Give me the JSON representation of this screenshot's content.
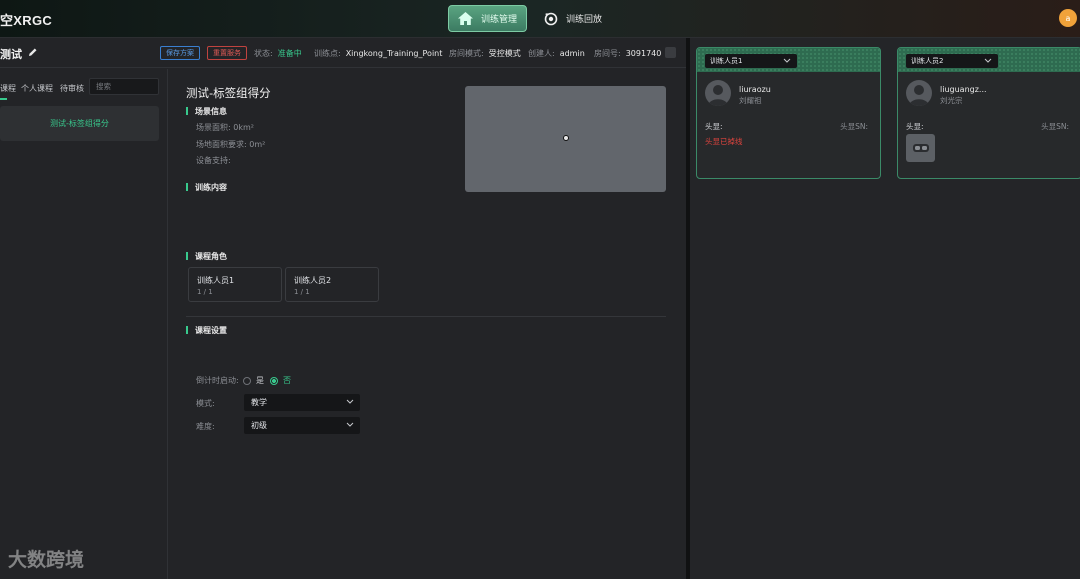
{
  "app": {
    "logo": "空XRGC"
  },
  "nav": {
    "manage_label": "训练管理",
    "replay_label": "训练回放"
  },
  "user": {
    "avatar_letter": "a"
  },
  "header": {
    "project_title": "测试",
    "save_plan": "保存方案",
    "reset_plan": "重置服务",
    "status_label": "状态:",
    "status_value": "准备中",
    "point_label": "训练点:",
    "point_value": "Xingkong_Training_Point",
    "mode_label": "房间模式:",
    "mode_value": "受控模式",
    "creator_label": "创建人:",
    "creator_value": "admin",
    "room_label": "房间号:",
    "room_value": "3091740"
  },
  "course_list": {
    "tabs": [
      "课程",
      "个人课程",
      "待审核"
    ],
    "search_placeholder": "搜索",
    "items": [
      "测试-标签组得分"
    ]
  },
  "detail": {
    "title": "测试-标签组得分",
    "scene_section": "场景信息",
    "scene_area": "场景面积:  0km²",
    "floor_area": "场地面积要求:  0m²",
    "device_support": "设备支持:",
    "content_section": "训练内容",
    "roles_section": "课程角色",
    "roles": [
      {
        "name": "训练人员1",
        "count": "1 / 1"
      },
      {
        "name": "训练人员2",
        "count": "1 / 1"
      }
    ],
    "settings_section": "课程设置",
    "countdown_label": "倒计时启动:",
    "countdown_yes": "是",
    "countdown_no": "否",
    "countdown_selected": "否",
    "mode_label": "模式:",
    "mode_value": "教学",
    "difficulty_label": "难度:",
    "difficulty_value": "初级"
  },
  "trainees": [
    {
      "role": "训练人员1",
      "username": "liuraozu",
      "realname": "刘耀祖",
      "hmd_label": "头显:",
      "sn_label": "头显SN:",
      "hmd_status": "头显已掉线",
      "online": false
    },
    {
      "role": "训练人员2",
      "username": "liuguangz...",
      "realname": "刘光宗",
      "hmd_label": "头显:",
      "sn_label": "头显SN:",
      "hmd_status": "",
      "online": true
    }
  ],
  "watermark": "大数跨境",
  "colors": {
    "accent": "#38c98d",
    "danger": "#e0443e",
    "link": "#3a7fd0"
  }
}
